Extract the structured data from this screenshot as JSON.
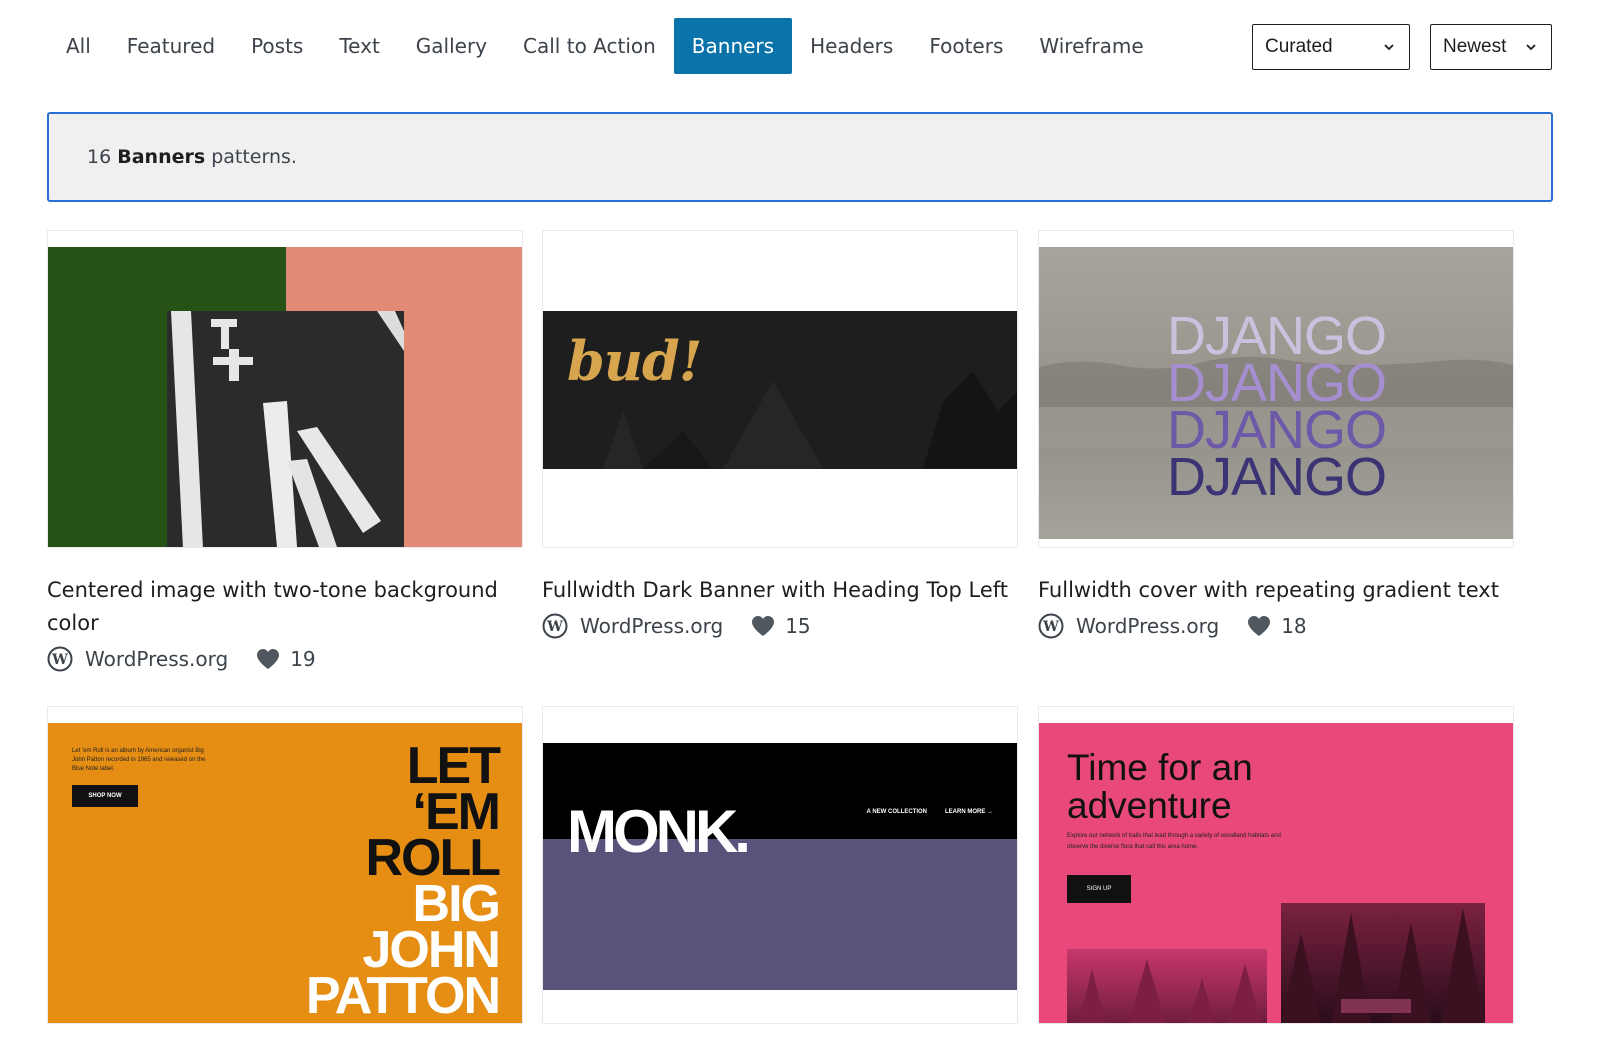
{
  "nav": {
    "tabs": [
      {
        "label": "All",
        "active": false
      },
      {
        "label": "Featured",
        "active": false
      },
      {
        "label": "Posts",
        "active": false
      },
      {
        "label": "Text",
        "active": false
      },
      {
        "label": "Gallery",
        "active": false
      },
      {
        "label": "Call to Action",
        "active": false
      },
      {
        "label": "Banners",
        "active": true
      },
      {
        "label": "Headers",
        "active": false
      },
      {
        "label": "Footers",
        "active": false
      },
      {
        "label": "Wireframe",
        "active": false
      }
    ],
    "curated_select": "Curated",
    "sort_select": "Newest",
    "accent_color": "#0a73aa"
  },
  "notice": {
    "count": "16",
    "category": "Banners",
    "suffix": "patterns."
  },
  "patterns": [
    {
      "title": "Centered image with two-tone background color",
      "author": "WordPress.org",
      "likes": "19"
    },
    {
      "title": "Fullwidth Dark Banner with Heading Top Left",
      "author": "WordPress.org",
      "likes": "15"
    },
    {
      "title": "Fullwidth cover with repeating gradient text",
      "author": "WordPress.org",
      "likes": "18"
    }
  ],
  "previews": {
    "bud": {
      "logo": "bud!"
    },
    "django": {
      "words": [
        "DJANGO",
        "DJANGO",
        "DJANGO",
        "DJANGO"
      ]
    },
    "patton": {
      "blurb": "Let 'em Roll is an album by American organist Big John Patton recorded in 1965 and released on the Blue Note label.",
      "button": "SHOP NOW",
      "lines": [
        "LET",
        "‘EM",
        "ROLL",
        "BIG",
        "JOHN",
        "PATTON"
      ]
    },
    "monk": {
      "logo": "MONK.",
      "link1": "A NEW COLLECTION",
      "link2": "LEARN MORE →"
    },
    "adventure": {
      "title": "Time for an adventure",
      "subtitle": "Explore our network of trails that lead through a variety of woodland habitats and observe the diverse flora that call this area home.",
      "button": "SIGN UP"
    }
  }
}
